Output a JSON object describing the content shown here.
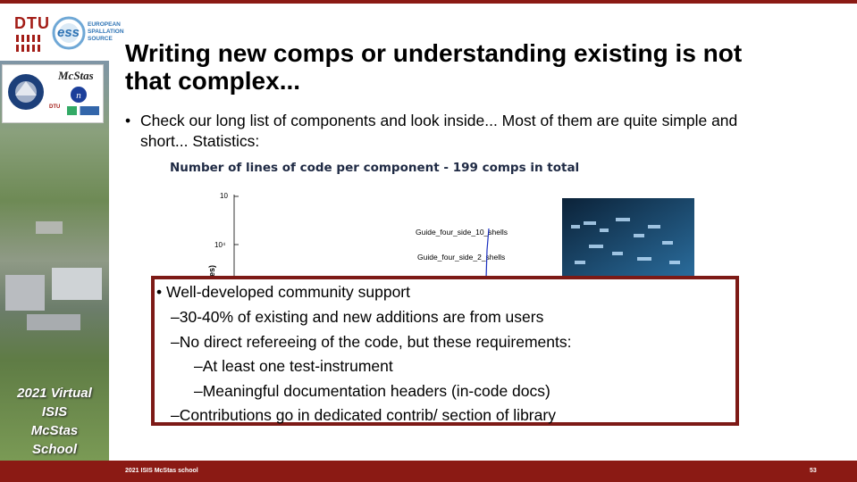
{
  "header": {
    "dtu_label": "DTU",
    "ess_lines": [
      "EUROPEAN",
      "SPALLATION",
      "SOURCE"
    ],
    "ess_label": "ess"
  },
  "sidebar": {
    "mcstas_label": "McStas",
    "dtu_small": "DTU",
    "school_lines": [
      "2021 Virtual",
      "ISIS",
      "McStas",
      "School"
    ]
  },
  "title": "Writing new comps or understanding existing is not that complex...",
  "bullet1": {
    "marker": "•",
    "text": "Check our long list of components and look inside... Most of them are quite simple and short... Statistics:"
  },
  "chart_data": {
    "type": "line",
    "title": "Number of lines of code per component - 199 comps in total",
    "ylabel": "es)",
    "y_ticks": [
      "10",
      "10⁴"
    ],
    "scale": "log",
    "annotations": [
      "Guide_four_side_10_shells",
      "Guide_four_side_2_shells"
    ]
  },
  "box": {
    "lines": [
      "• Well-developed community support",
      "–30-40% of existing and new additions are from users",
      "–No direct refereeing of the code, but these requirements:",
      "–At least one test-instrument",
      "–Meaningful documentation headers (in-code docs)",
      "–Contributions go in dedicated contrib/ section of library"
    ]
  },
  "footer": {
    "left": "2021 ISIS McStas school",
    "right": "53"
  },
  "colors": {
    "brand": "#8b1a14",
    "box_border": "#7d1a16",
    "chart_line": "#1a2fbf"
  }
}
